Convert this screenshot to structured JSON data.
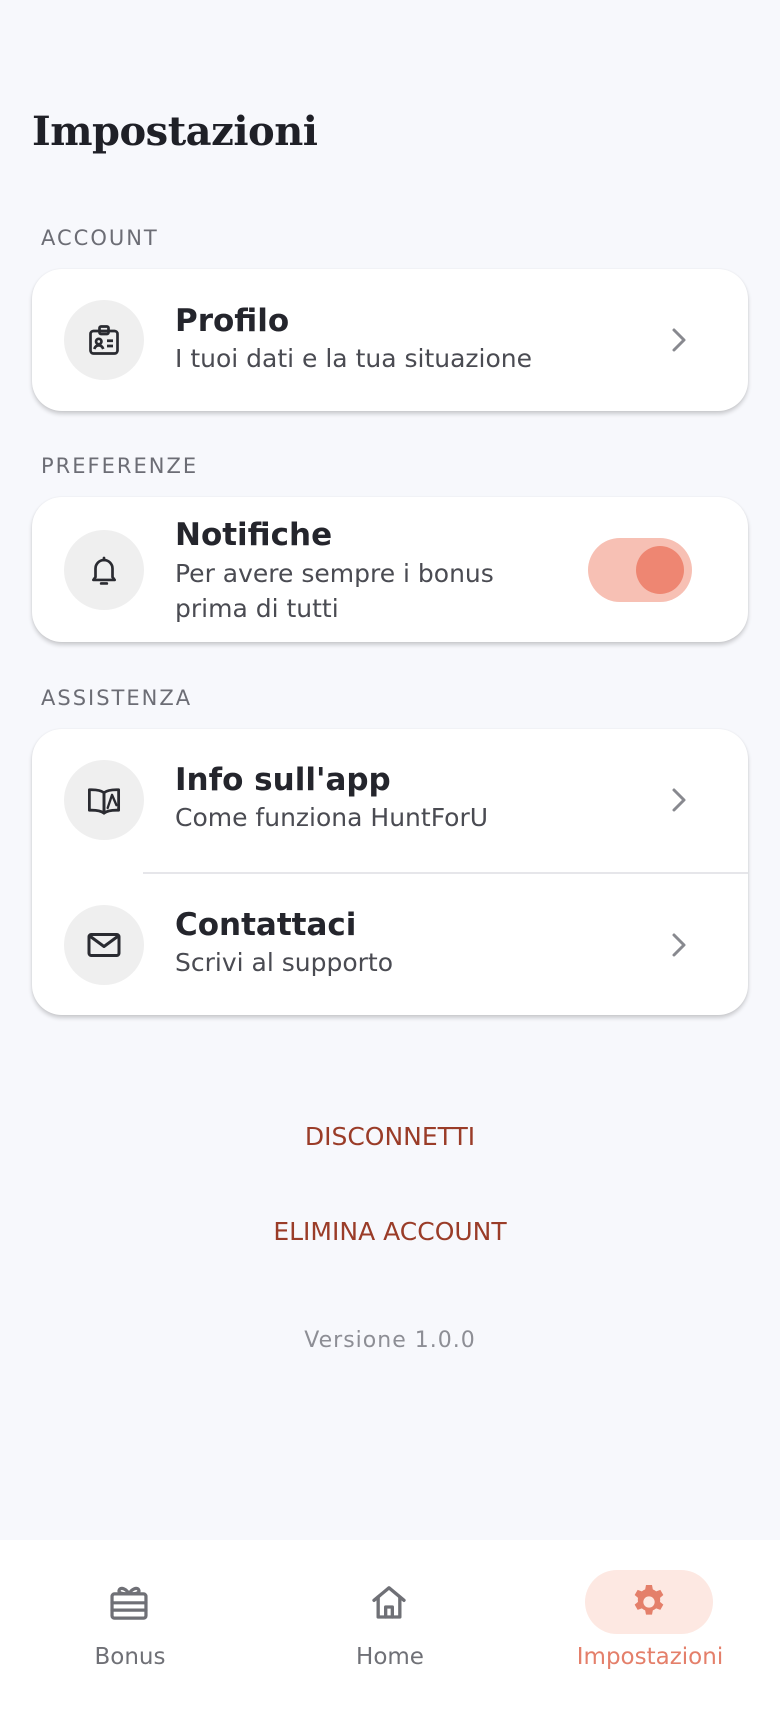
{
  "header": {
    "title": "Impostazioni"
  },
  "sections": {
    "account": {
      "label": "ACCOUNT",
      "items": [
        {
          "title": "Profilo",
          "subtitle": "I tuoi dati e la tua situazione",
          "icon": "id-badge-icon"
        }
      ]
    },
    "preferenze": {
      "label": "PREFERENZE",
      "items": [
        {
          "title": "Notifiche",
          "subtitle": "Per avere sempre i bonus prima di tutti",
          "icon": "bell-icon",
          "toggle_on": true
        }
      ]
    },
    "assistenza": {
      "label": "ASSISTENZA",
      "items": [
        {
          "title": "Info sull'app",
          "subtitle": "Come funziona HuntForU",
          "icon": "book-icon"
        },
        {
          "title": "Contattaci",
          "subtitle": "Scrivi al supporto",
          "icon": "mail-icon"
        }
      ]
    }
  },
  "actions": {
    "logout": "DISCONNETTI",
    "delete_account": "ELIMINA ACCOUNT"
  },
  "version": "Versione 1.0.0",
  "bottom_nav": {
    "items": [
      {
        "label": "Bonus",
        "icon": "gift-icon",
        "active": false
      },
      {
        "label": "Home",
        "icon": "home-icon",
        "active": false
      },
      {
        "label": "Impostazioni",
        "icon": "gear-icon",
        "active": true
      }
    ]
  },
  "colors": {
    "accent": "#E47F6A",
    "toggle_track": "#F7C0B4",
    "toggle_knob": "#EE8672",
    "danger_text": "#9A3C28",
    "background": "#F7F8FC"
  }
}
